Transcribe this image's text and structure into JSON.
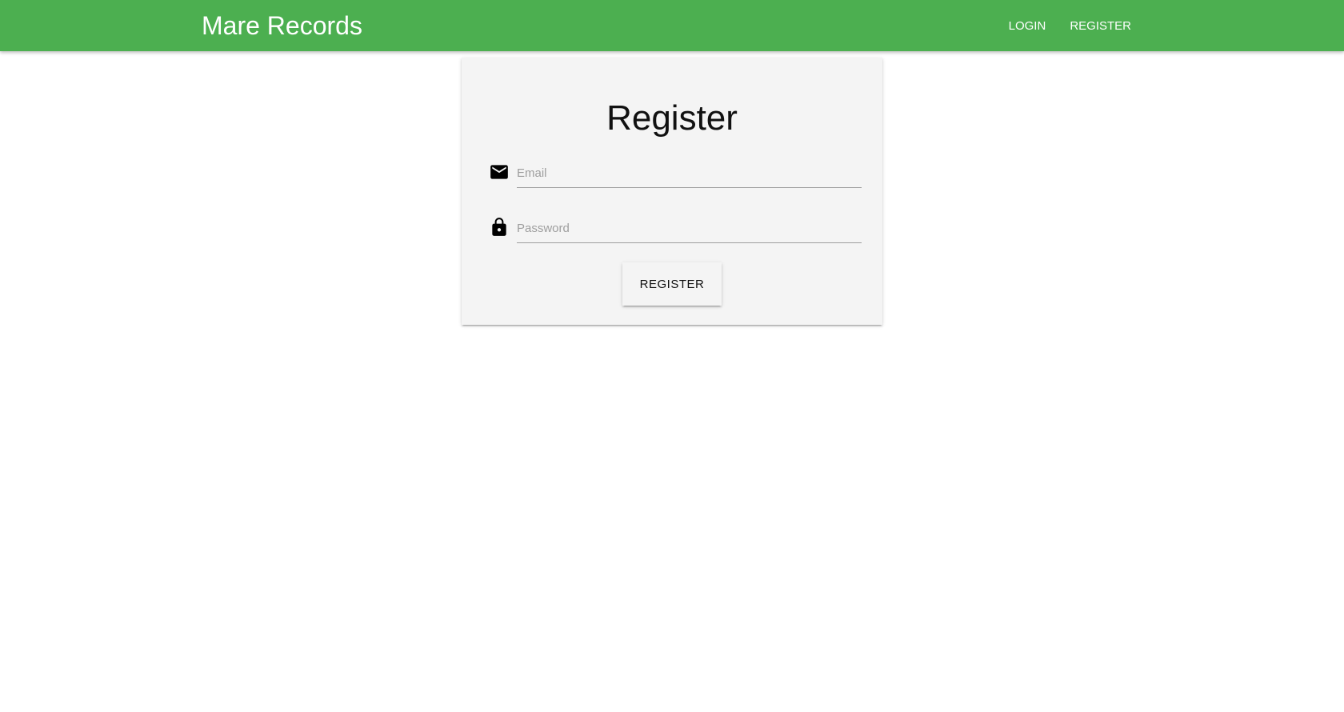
{
  "navbar": {
    "brand": "Mare Records",
    "links": [
      {
        "label": "LOGIN"
      },
      {
        "label": "REGISTER"
      }
    ],
    "background_color": "#4caf50"
  },
  "form": {
    "title": "Register",
    "email": {
      "placeholder": "Email",
      "value": "",
      "icon": "email-icon"
    },
    "password": {
      "placeholder": "Password",
      "value": "",
      "icon": "lock-icon"
    },
    "submit_label": "REGISTER"
  }
}
